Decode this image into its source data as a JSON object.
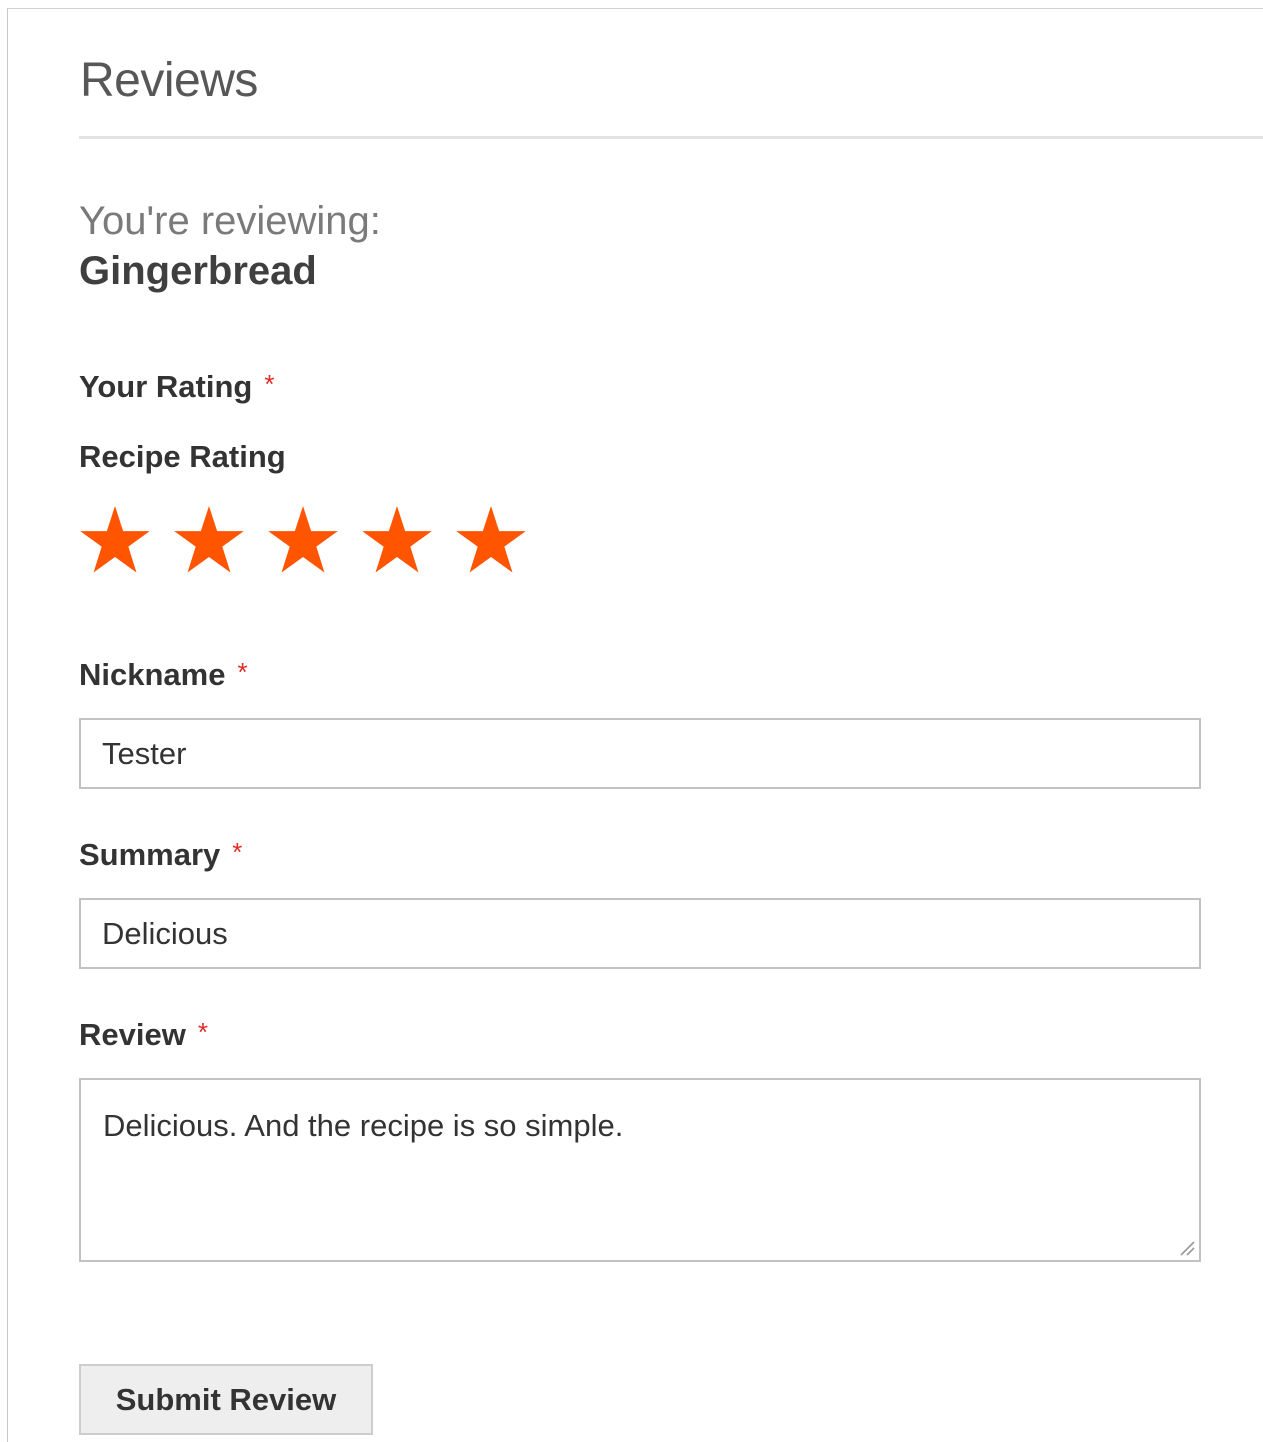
{
  "block": {
    "title": "Reviews"
  },
  "product": {
    "reviewing_label": "You're reviewing:",
    "name": "Gingerbread"
  },
  "rating": {
    "label": "Your Rating",
    "required_mark": "*",
    "criterion_label": "Recipe Rating",
    "value": 5,
    "max": 5,
    "star_color": "#ff5501",
    "star_icon": "star-icon"
  },
  "nickname": {
    "label": "Nickname",
    "required_mark": "*",
    "value": "Tester"
  },
  "summary": {
    "label": "Summary",
    "required_mark": "*",
    "value": "Delicious"
  },
  "review": {
    "label": "Review",
    "required_mark": "*",
    "value": "Delicious. And the recipe is so simple."
  },
  "actions": {
    "submit_label": "Submit Review"
  },
  "colors": {
    "required": "#e02b27",
    "input_border": "#c2c2c2",
    "button_bg": "#eeeeee"
  }
}
